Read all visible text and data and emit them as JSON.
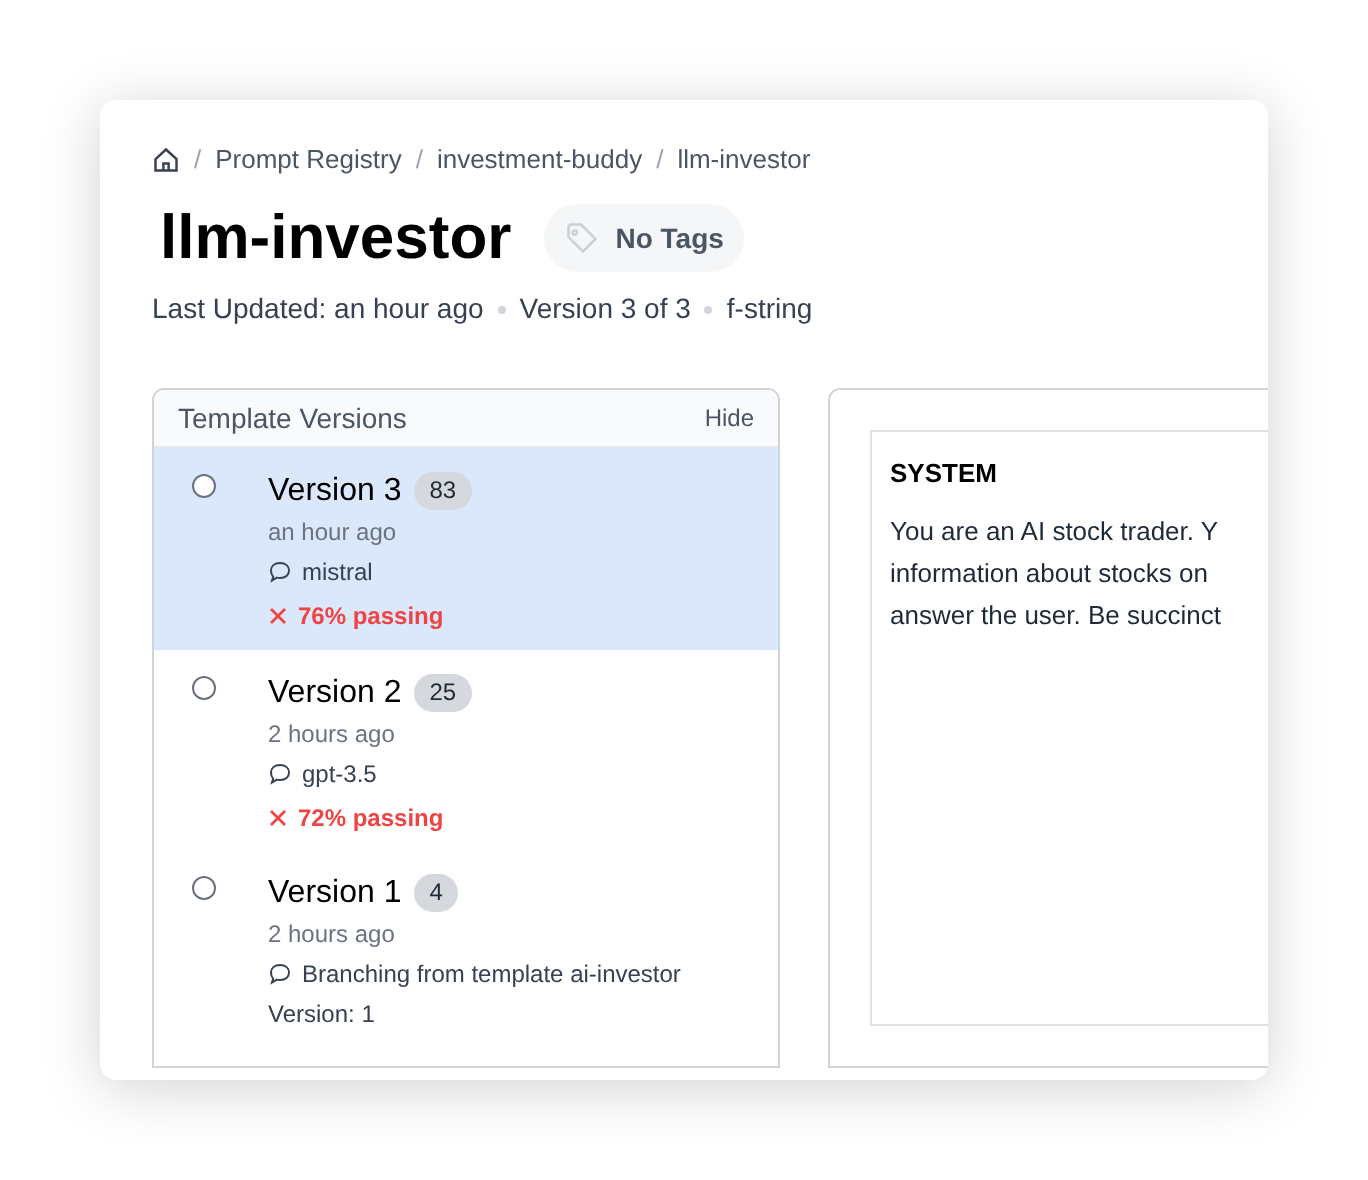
{
  "breadcrumb": {
    "separator": "/",
    "items": [
      "Prompt Registry",
      "investment-buddy",
      "llm-investor"
    ]
  },
  "title": "llm-investor",
  "tags": {
    "label": "No Tags"
  },
  "meta": [
    "Last Updated: an hour ago",
    "Version 3 of 3",
    "f-string"
  ],
  "versions_panel": {
    "title": "Template Versions",
    "hide": "Hide",
    "versions": [
      {
        "name": "Version 3",
        "count": "83",
        "time": "an hour ago",
        "model": "mistral",
        "passed": false,
        "result": "76% passing",
        "selected": true
      },
      {
        "name": "Version 2",
        "count": "25",
        "time": "2 hours ago",
        "model": "gpt-3.5",
        "passed": false,
        "result": "72% passing",
        "selected": false
      },
      {
        "name": "Version 1",
        "count": "4",
        "time": "2 hours ago",
        "model": "Branching from template ai-investor",
        "note": "Version: 1",
        "selected": false
      }
    ]
  },
  "prompt": {
    "role": "SYSTEM",
    "lines": [
      "You are an AI stock trader. Y",
      "information about stocks on",
      "answer the user. Be succinct"
    ]
  }
}
